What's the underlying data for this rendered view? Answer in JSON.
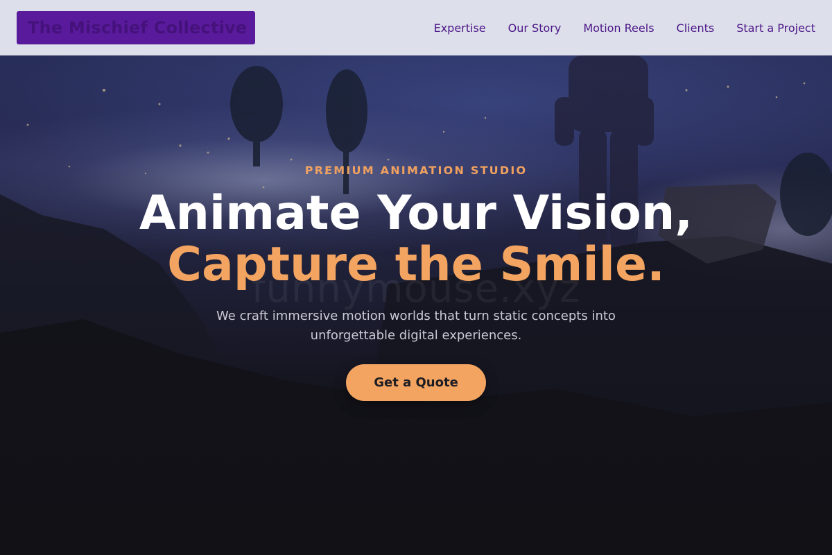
{
  "brand": {
    "name": "The Mischief Collective"
  },
  "nav": [
    {
      "label": "Expertise"
    },
    {
      "label": "Our Story"
    },
    {
      "label": "Motion Reels"
    },
    {
      "label": "Clients"
    },
    {
      "label": "Start a Project"
    }
  ],
  "hero": {
    "eyebrow": "PREMIUM ANIMATION STUDIO",
    "title_line1": "Animate Your Vision,",
    "title_line2": "Capture the Smile.",
    "subtitle": "We craft immersive motion worlds that turn static concepts into unforgettable digital experiences.",
    "cta_label": "Get a Quote",
    "watermark": "funnymouse.xyz"
  },
  "colors": {
    "accent": "#f3a461",
    "brand_purple": "#5a1a9c",
    "nav_text": "#4b1488",
    "header_bg": "#dde0ea",
    "hero_dark": "#131318"
  }
}
